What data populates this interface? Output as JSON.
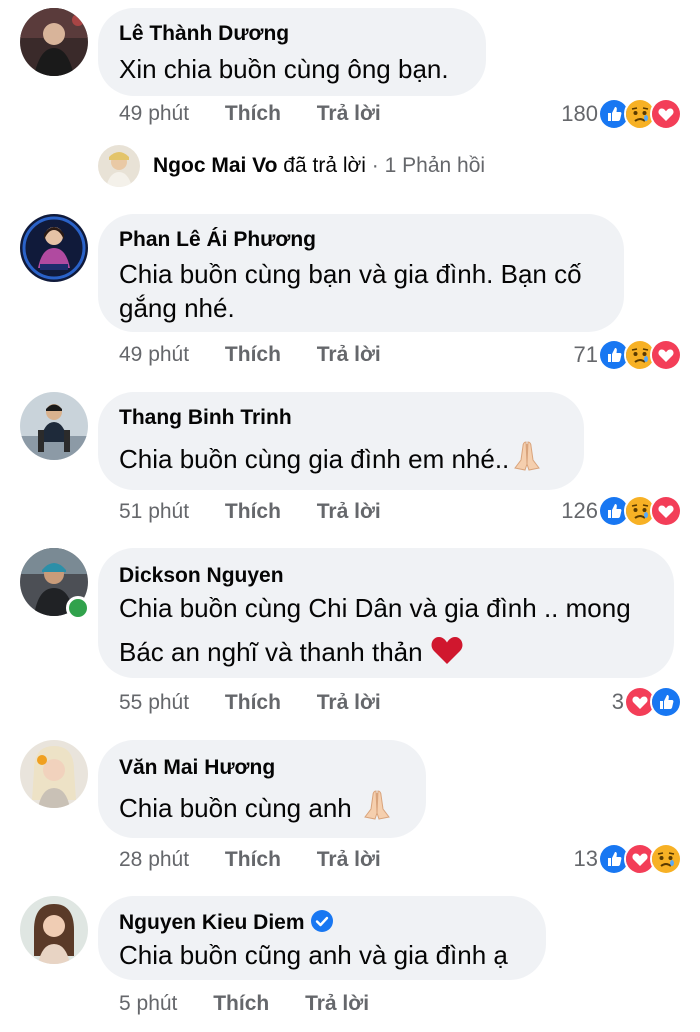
{
  "comments": [
    {
      "author": "Lê Thành Dương",
      "text": "Xin chia buồn cùng ông bạn.",
      "time": "49 phút",
      "like_label": "Thích",
      "reply_label": "Trả lời",
      "reaction_count": "180",
      "reactions": [
        "like",
        "sad",
        "love"
      ]
    },
    {
      "author": "Phan Lê Ái Phương",
      "text_line1": "Chia buồn cùng bạn và gia đình. Bạn cố",
      "text_line2": "gắng nhé.",
      "time": "49 phút",
      "like_label": "Thích",
      "reply_label": "Trả lời",
      "reaction_count": "71",
      "reactions": [
        "like",
        "sad",
        "love"
      ]
    },
    {
      "author": "Thang Binh Trinh",
      "text": "Chia buồn cùng gia đình em nhé..",
      "emoji": "folded-hands",
      "time": "51 phút",
      "like_label": "Thích",
      "reply_label": "Trả lời",
      "reaction_count": "126",
      "reactions": [
        "like",
        "sad",
        "love"
      ]
    },
    {
      "author": "Dickson Nguyen",
      "text_line1": "Chia buồn cùng Chi Dân và gia đình .. mong",
      "text_line2": "Bác an nghĩ và thanh thản",
      "emoji": "red-heart",
      "time": "55 phút",
      "like_label": "Thích",
      "reply_label": "Trả lời",
      "reaction_count": "3",
      "reactions": [
        "love",
        "like"
      ],
      "online": true
    },
    {
      "author": "Văn Mai Hương",
      "text": "Chia buồn cùng anh",
      "emoji": "folded-hands",
      "time": "28 phút",
      "like_label": "Thích",
      "reply_label": "Trả lời",
      "reaction_count": "13",
      "reactions": [
        "like",
        "love",
        "sad"
      ]
    },
    {
      "author": "Nguyen Kieu Diem",
      "verified": true,
      "text": "Chia buồn cũng anh và gia đình ạ",
      "time": "5 phút",
      "like_label": "Thích",
      "reply_label": "Trả lời"
    }
  ],
  "reply_summary": {
    "name": "Ngoc Mai Vo",
    "action": "đã trả lời",
    "separator": "·",
    "count_text": "1 Phản hồi"
  },
  "colors": {
    "bubble": "#f0f2f5",
    "meta_text": "#65676b",
    "like_blue": "#1877f2",
    "love_red": "#f33e58",
    "sad_yellow": "#f7b125",
    "online_green": "#31a24c"
  }
}
